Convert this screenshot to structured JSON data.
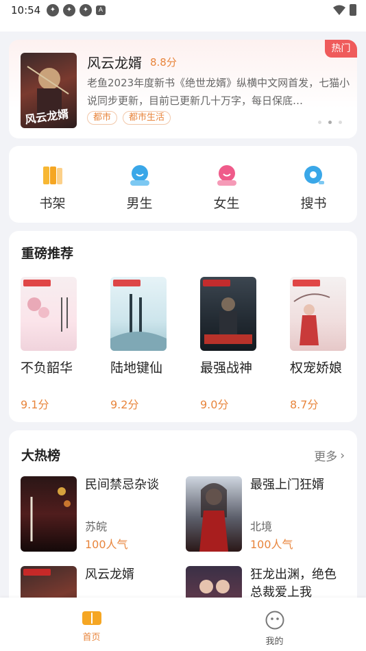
{
  "status": {
    "time": "10:54"
  },
  "banner": {
    "hot_tag": "热门",
    "title": "风云龙婿",
    "score": "8.8分",
    "desc": "老鱼2023年度新书《绝世龙婿》纵横中文网首发，七猫小说同步更新，目前已更新几十万字，每日保底…",
    "tags": [
      "都市",
      "都市生活"
    ],
    "cover_text": "风云龙婿"
  },
  "quicknav": [
    {
      "label": "书架",
      "icon": "bookshelf-icon",
      "color": "#f5a623"
    },
    {
      "label": "男生",
      "icon": "male-icon",
      "color": "#3aa7e8"
    },
    {
      "label": "女生",
      "icon": "female-icon",
      "color": "#ef5b8a"
    },
    {
      "label": "搜书",
      "icon": "search-icon",
      "color": "#3aa7e8"
    }
  ],
  "recommend": {
    "title": "重磅推荐",
    "books": [
      {
        "title": "不负韶华",
        "score": "9.1分"
      },
      {
        "title": "陆地键仙",
        "score": "9.2分"
      },
      {
        "title": "最强战神",
        "score": "9.0分"
      },
      {
        "title": "权宠娇娘",
        "score": "8.7分"
      }
    ]
  },
  "hotlist": {
    "title": "大热榜",
    "more": "更多",
    "books": [
      {
        "title": "民间禁忌杂谈",
        "author": "苏皖",
        "popularity": "100人气"
      },
      {
        "title": "最强上门狂婿",
        "author": "北境",
        "popularity": "100人气"
      },
      {
        "title": "风云龙婿",
        "author": "",
        "popularity": ""
      },
      {
        "title": "狂龙出渊，绝色总裁爱上我",
        "author": "",
        "popularity": ""
      }
    ]
  },
  "bottomnav": [
    {
      "label": "首页",
      "active": true
    },
    {
      "label": "我的",
      "active": false
    }
  ],
  "colors": {
    "accent": "#e8853c",
    "hot": "#ef5b5b"
  }
}
